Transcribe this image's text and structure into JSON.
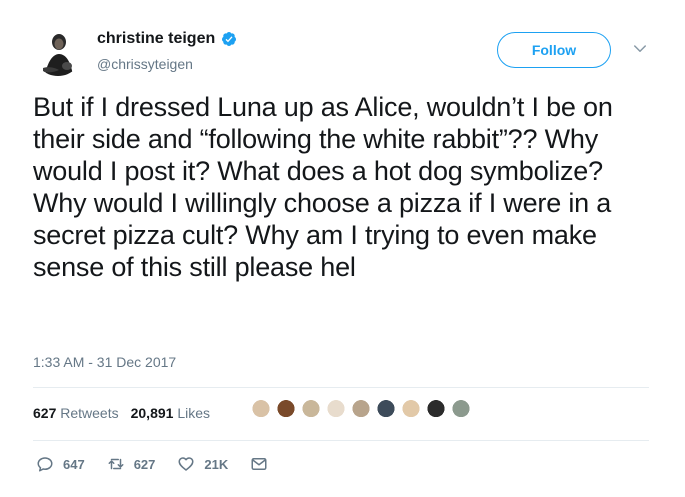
{
  "author": {
    "name": "christine teigen",
    "handle": "@chrissyteigen",
    "verified": true
  },
  "follow_label": "Follow",
  "tweet": {
    "text": "But if I dressed Luna up as Alice, wouldn’t I be on their side and “following the white rabbit”?? Why would I post it? What does a hot dog symbolize? Why would I willingly choose a pizza if I were in a secret pizza cult? Why am I trying to even make sense of this still please hel",
    "timestamp": "1:33 AM - 31 Dec 2017"
  },
  "stats": {
    "retweets_count": "627",
    "retweets_label": "Retweets",
    "likes_count": "20,891",
    "likes_label": "Likes"
  },
  "likers": [
    {
      "color": "#d9c2a6"
    },
    {
      "color": "#7a4a2a"
    },
    {
      "color": "#c9b79a"
    },
    {
      "color": "#e8dccd"
    },
    {
      "color": "#b8a48c"
    },
    {
      "color": "#3d4b5a"
    },
    {
      "color": "#e2c9a8"
    },
    {
      "color": "#2b2b2b"
    },
    {
      "color": "#8c9a8e"
    }
  ],
  "actions": {
    "reply_count": "647",
    "retweet_count": "627",
    "like_count": "21K"
  },
  "colors": {
    "accent": "#1da1f2",
    "muted": "#657786",
    "text": "#14171a"
  }
}
